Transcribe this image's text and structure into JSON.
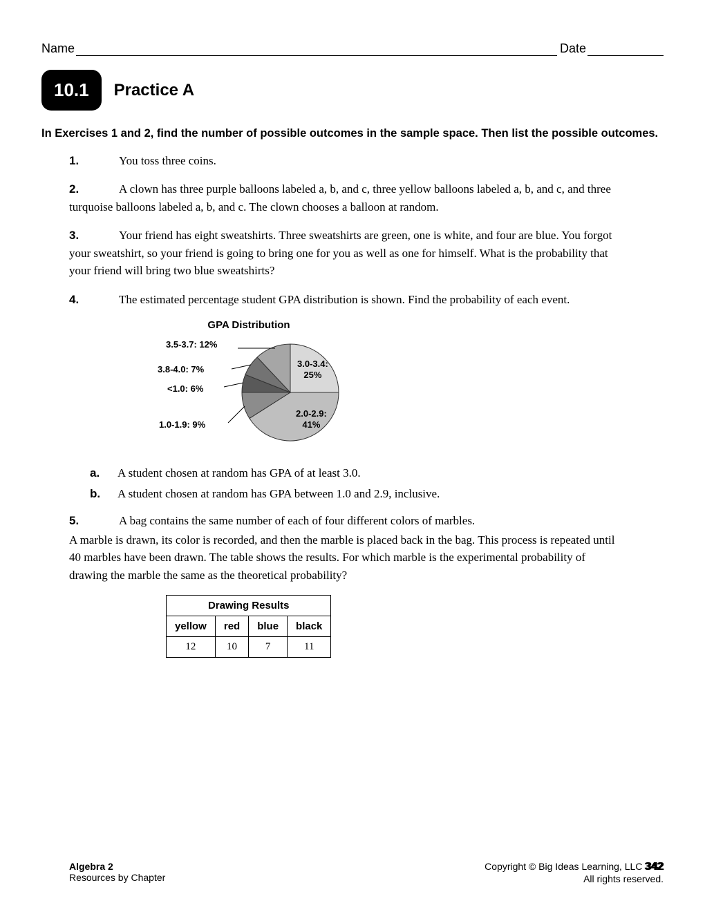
{
  "header": {
    "name_label": "Name",
    "date_label": "Date"
  },
  "lesson": {
    "number": "10.1",
    "title": "Practice A"
  },
  "instructions": "In Exercises 1 and 2, find the number of possible outcomes in the sample space. Then list the possible outcomes.",
  "ex": {
    "n1": "1.",
    "t1": "You toss three coins.",
    "n2": "2.",
    "t2": "A clown has three purple balloons labeled a, b, and c, three yellow balloons labeled a, b, and c, and three turquoise balloons labeled a, b, and c. The clown chooses a balloon at random.",
    "n3": "3.",
    "t3": "Your friend has eight sweatshirts. Three sweatshirts are green, one is white, and four are blue. You forgot your sweatshirt, so your friend is going to bring one for you as well as one for himself. What is the probability that your friend will bring two blue sweatshirts?",
    "n4": "4.",
    "t4": "The estimated percentage student GPA distribution is shown. Find the probability of each event.",
    "a4": "a.",
    "ta4": "A student chosen at random has GPA of at least 3.0.",
    "b4": "b.",
    "tb4": "A student chosen at random has GPA between 1.0 and 2.9, inclusive.",
    "n5": "5.",
    "t5a": "A bag contains the same number of each of four different colors of marbles.",
    "t5b": "A marble is drawn, its color is recorded, and then the marble is placed back in the bag. This process is repeated until 40 marbles have been drawn. The table shows the results. For which marble is the experimental probability of drawing the marble the same as the theoretical probability?"
  },
  "chart_data": {
    "type": "pie",
    "title": "GPA Distribution",
    "series": [
      {
        "name": "3.0-3.4",
        "value": 25,
        "label": "3.0-3.4: 25%"
      },
      {
        "name": "2.0-2.9",
        "value": 41,
        "label": "2.0-2.9: 41%"
      },
      {
        "name": "1.0-1.9",
        "value": 9,
        "label": "1.0-1.9: 9%"
      },
      {
        "name": "<1.0",
        "value": 6,
        "label": "<1.0: 6%"
      },
      {
        "name": "3.8-4.0",
        "value": 7,
        "label": "3.8-4.0: 7%"
      },
      {
        "name": "3.5-3.7",
        "value": 12,
        "label": "3.5-3.7: 12%"
      }
    ],
    "inner_labels": {
      "s0a": "3.0-3.4:",
      "s0b": "25%",
      "s1a": "2.0-2.9:",
      "s1b": "41%"
    }
  },
  "table": {
    "caption": "Drawing Results",
    "headers": [
      "yellow",
      "red",
      "blue",
      "black"
    ],
    "row": [
      "12",
      "10",
      "7",
      "11"
    ]
  },
  "footer": {
    "book": "Algebra 2",
    "subtitle": "Resources by Chapter",
    "copyright": "Copyright © Big Ideas Learning, LLC",
    "rights": "All rights reserved.",
    "page": "342"
  }
}
